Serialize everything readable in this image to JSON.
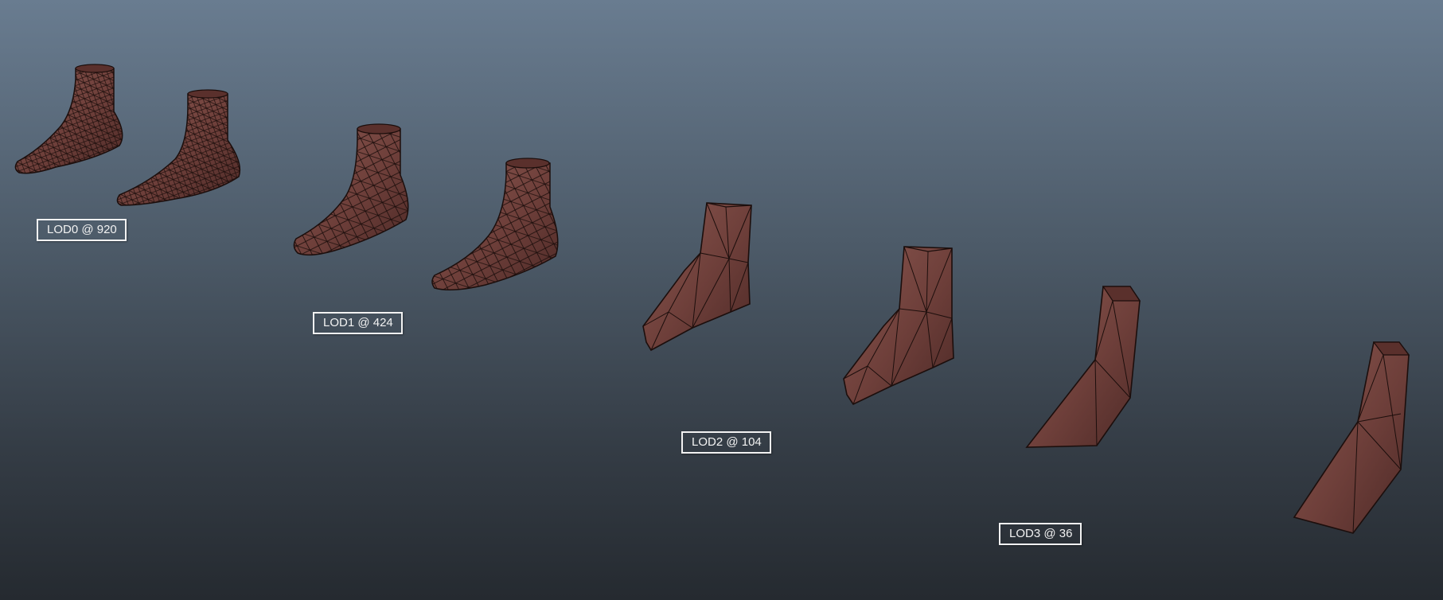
{
  "viewport": {
    "background_top": "#697c90",
    "background_bottom": "#252a30"
  },
  "mesh": {
    "fill_color": "#6e3f3a",
    "wire_color": "#1c0e0c"
  },
  "lods": [
    {
      "label": "LOD0 @ 920",
      "level": 0,
      "triangles": 920
    },
    {
      "label": "LOD1 @ 424",
      "level": 1,
      "triangles": 424
    },
    {
      "label": "LOD2 @ 104",
      "level": 2,
      "triangles": 104
    },
    {
      "label": "LOD3 @ 36",
      "level": 3,
      "triangles": 36
    }
  ]
}
